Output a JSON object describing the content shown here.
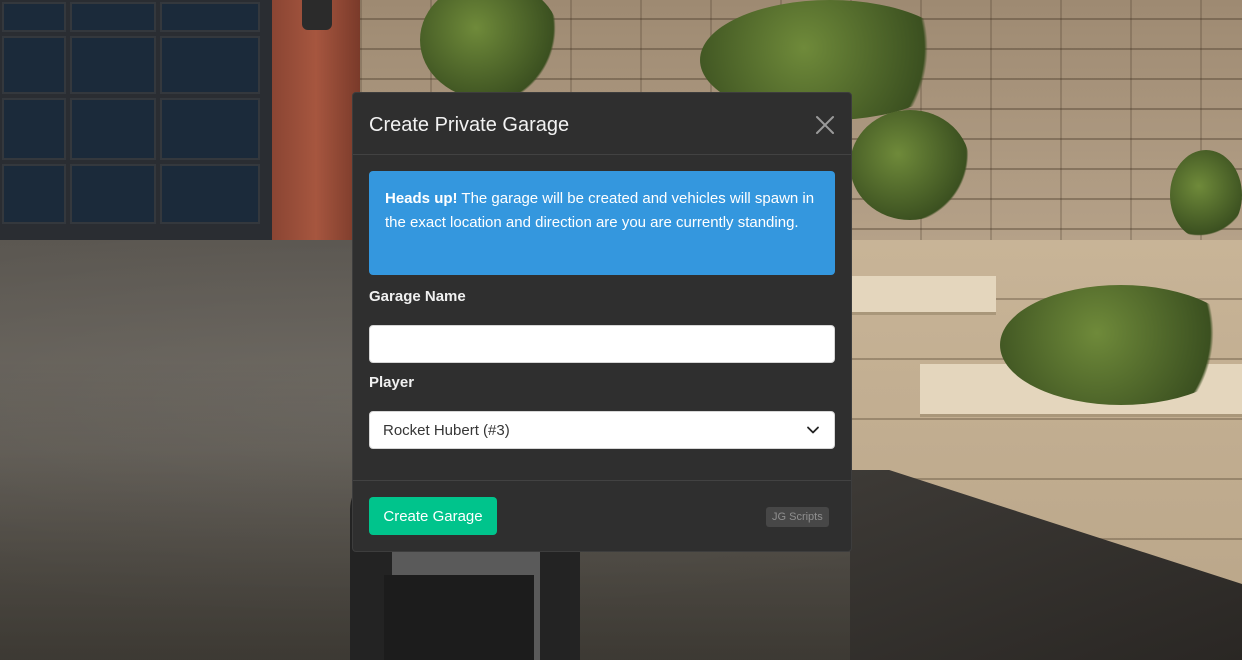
{
  "modal": {
    "title": "Create Private Garage",
    "close_icon": "close-icon",
    "alert": {
      "heading": "Heads up!",
      "message": " The garage will be created and vehicles will spawn in the exact location and direction are you are currently standing.",
      "color": "#3497de"
    },
    "fields": {
      "garage_name": {
        "label": "Garage Name",
        "value": "",
        "placeholder": ""
      },
      "player": {
        "label": "Player",
        "selected": "Rocket Hubert (#3)",
        "icon": "chevron-down-icon"
      }
    },
    "footer": {
      "create_button": "Create Garage",
      "create_button_color": "#00c48c",
      "brand": "JG Scripts"
    }
  }
}
